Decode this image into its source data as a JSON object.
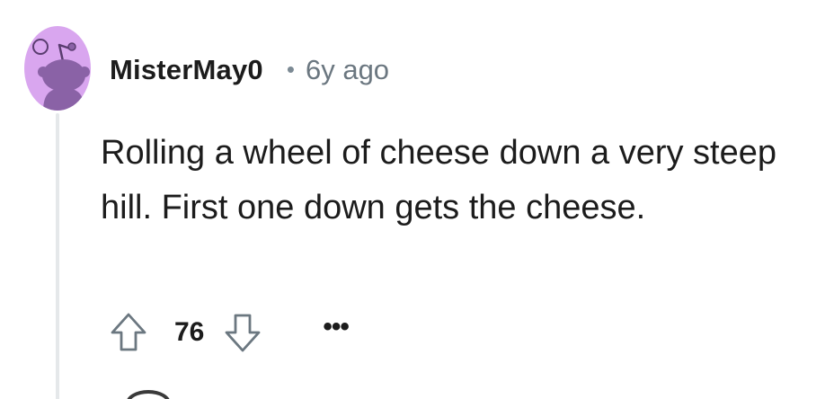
{
  "comment": {
    "username": "MisterMay0",
    "separator": "•",
    "timestamp": "6y ago",
    "body": "Rolling a wheel of cheese down a very steep hill. First one down gets the cheese.",
    "votes": "76",
    "more_label": "•••"
  },
  "icons": {
    "avatar": "snoo-avatar-icon",
    "upvote": "upvote-arrow-icon",
    "downvote": "downvote-arrow-icon",
    "more": "more-options-icon"
  },
  "colors": {
    "avatar_bg": "#d9a6ef",
    "avatar_figure": "#8a62a6",
    "text": "#1c1c1c",
    "muted": "#6b7780",
    "thread_line": "#e5e8ea"
  }
}
